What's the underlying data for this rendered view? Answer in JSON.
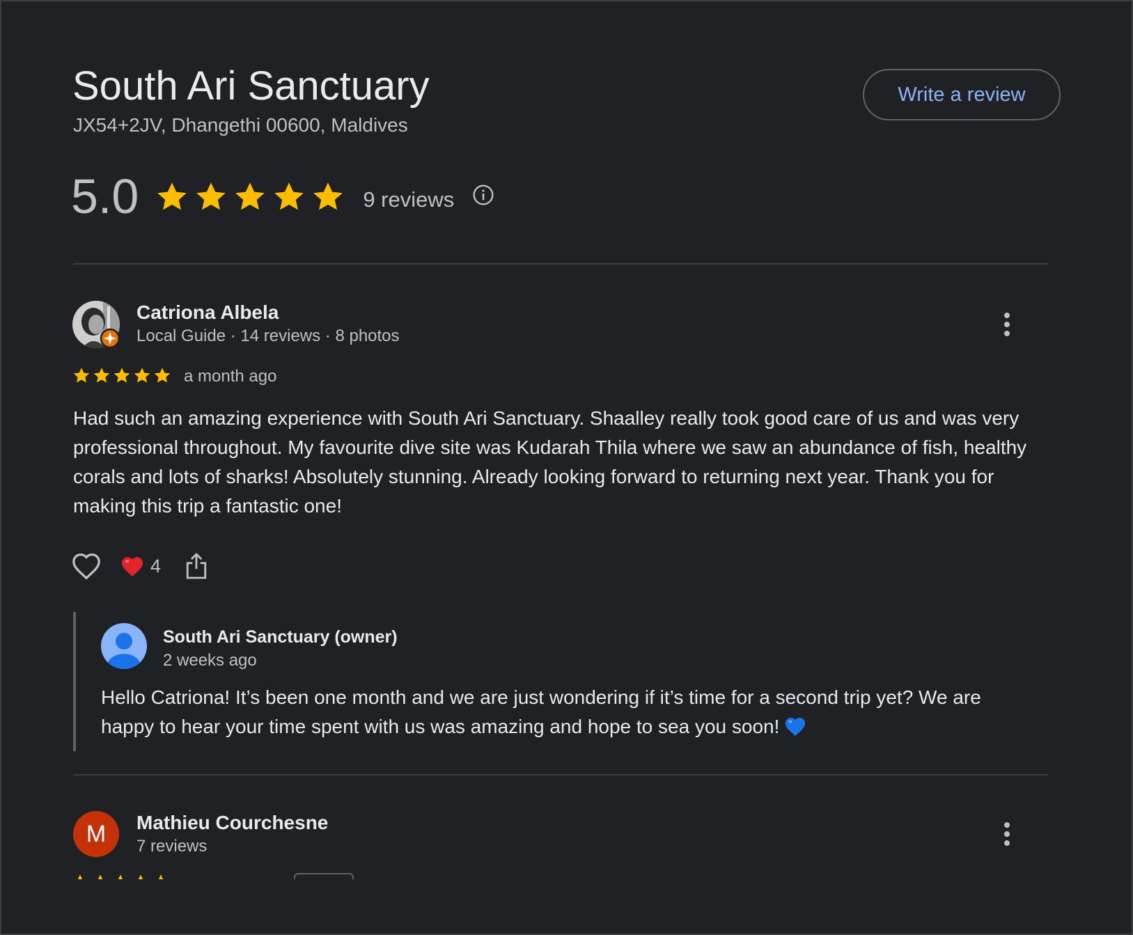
{
  "place": {
    "name": "South Ari Sanctuary",
    "address": "JX54+2JV, Dhangethi 00600, Maldives",
    "write_review_label": "Write a review"
  },
  "summary": {
    "rating": "5.0",
    "stars": 5,
    "review_count": "9 reviews",
    "info_icon": "info-icon"
  },
  "colors": {
    "background": "#202124",
    "star": "#fbbc04",
    "link": "#8ab4f8",
    "divider": "#3c4043",
    "local_guide_badge": "#e8710a",
    "owner_avatar": "#8ab4f8",
    "letter_avatar": "#c4320a"
  },
  "reviews": [
    {
      "author": "Catriona Albela",
      "meta": "Local Guide · 14 reviews · 8 photos",
      "stars": 5,
      "time": "a month ago",
      "text": "Had such an amazing experience with South Ari Sanctuary. Shaalley really took good care of us and was very professional throughout. My favourite dive site was Kudarah Thila where we saw an abundance of fish, healthy corals and lots of sharks! Absolutely stunning. Already looking forward to returning next year. Thank you for making this trip a fantastic one!",
      "reactions": {
        "like_icon": "heart-outline-icon",
        "reaction_icon": "red-heart-icon",
        "reaction_count": "4",
        "share_icon": "share-icon"
      },
      "owner_response": {
        "author": "South Ari Sanctuary (owner)",
        "time": "2 weeks ago",
        "text": "Hello Catriona! It’s been one month and we are just wondering if it’s time for a second trip yet? We are happy to hear your time spent with us was amazing and hope to sea you soon!",
        "emoji": "blue-heart-icon"
      }
    },
    {
      "author": "Mathieu Courchesne",
      "avatar_letter": "M",
      "meta": "7 reviews",
      "stars": 5
    }
  ]
}
